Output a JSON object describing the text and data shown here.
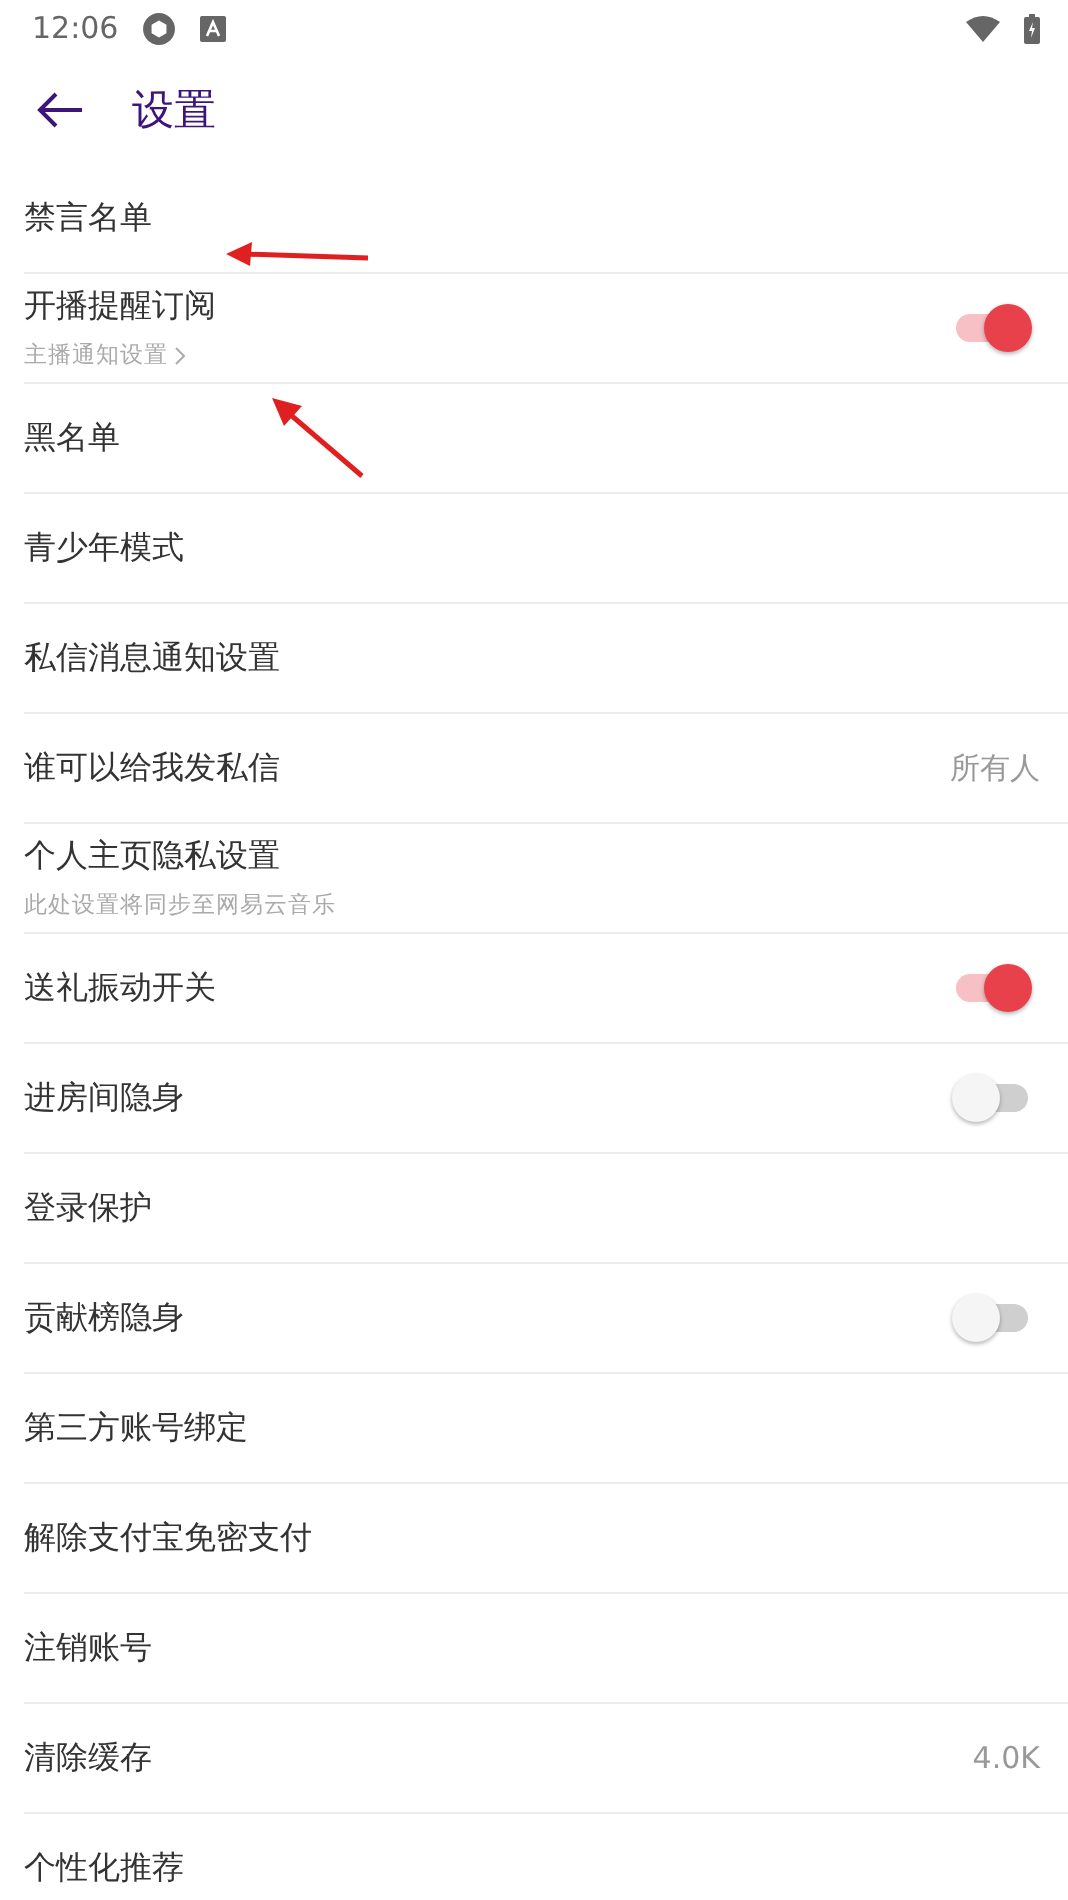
{
  "status_bar": {
    "time": "12:06"
  },
  "header": {
    "title": "设置"
  },
  "rows": [
    {
      "kind": "plain",
      "label": "禁言名单"
    },
    {
      "kind": "toggle",
      "label": "开播提醒订阅",
      "sublink": "主播通知设置",
      "on": true
    },
    {
      "kind": "plain",
      "label": "黑名单"
    },
    {
      "kind": "plain",
      "label": "青少年模式"
    },
    {
      "kind": "plain",
      "label": "私信消息通知设置"
    },
    {
      "kind": "value",
      "label": "谁可以给我发私信",
      "value": "所有人"
    },
    {
      "kind": "plain",
      "label": "个人主页隐私设置",
      "subtitle": "此处设置将同步至网易云音乐"
    },
    {
      "kind": "toggle",
      "label": "送礼振动开关",
      "on": true
    },
    {
      "kind": "toggle",
      "label": "进房间隐身",
      "on": false
    },
    {
      "kind": "plain",
      "label": "登录保护"
    },
    {
      "kind": "toggle",
      "label": "贡献榜隐身",
      "on": false
    },
    {
      "kind": "plain",
      "label": "第三方账号绑定"
    },
    {
      "kind": "plain",
      "label": "解除支付宝免密支付"
    },
    {
      "kind": "plain",
      "label": "注销账号"
    },
    {
      "kind": "value",
      "label": "清除缓存",
      "value": "4.0K"
    },
    {
      "kind": "plain",
      "label": "个性化推荐"
    }
  ]
}
